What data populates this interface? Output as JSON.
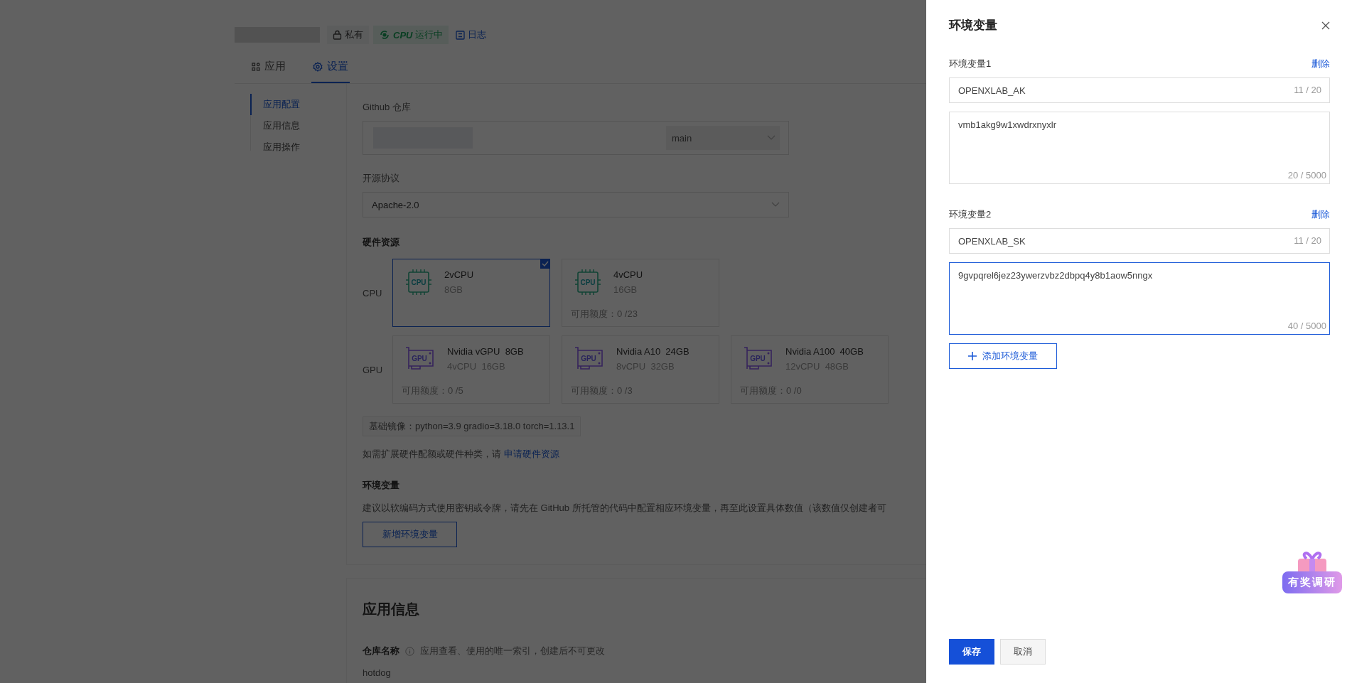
{
  "header": {
    "visibility": "私有",
    "status_hardware": "CPU",
    "status": "运行中",
    "log_link": "日志"
  },
  "tabs": [
    {
      "label": "应用",
      "selected": false
    },
    {
      "label": "设置",
      "selected": true
    }
  ],
  "side_nav": [
    {
      "label": "应用配置",
      "selected": true
    },
    {
      "label": "应用信息",
      "selected": false
    },
    {
      "label": "应用操作",
      "selected": false
    }
  ],
  "config": {
    "repo": {
      "label": "Github 仓库",
      "branch": "main"
    },
    "license": {
      "label": "开源协议",
      "value": "Apache-2.0"
    },
    "hardware": {
      "title": "硬件资源",
      "groups": [
        {
          "label": "CPU",
          "kind": "cpu",
          "options": [
            {
              "icon_text": "CPU",
              "name": "2vCPU",
              "spec": "8GB",
              "selected": true
            },
            {
              "icon_text": "CPU",
              "name": "4vCPU",
              "spec": "16GB",
              "quota": "可用额度：0 /23",
              "selected": false
            }
          ]
        },
        {
          "label": "GPU",
          "kind": "gpu",
          "options": [
            {
              "icon_text": "GPU",
              "name": "Nvidia vGPU  8GB",
              "spec": "4vCPU  16GB",
              "quota": "可用额度：0 /5",
              "selected": false
            },
            {
              "icon_text": "GPU",
              "name": "Nvidia A10  24GB",
              "spec": "8vCPU  32GB",
              "quota": "可用额度：0 /3",
              "selected": false
            },
            {
              "icon_text": "GPU",
              "name": "Nvidia A100  40GB",
              "spec": "12vCPU  48GB",
              "quota": "可用额度：0 /0",
              "selected": false
            }
          ]
        }
      ]
    },
    "base_image": "基础镜像：python=3.9 gradio=3.18.0 torch=1.13.1",
    "expand_note": {
      "text": "如需扩展硬件配额或硬件种类，请",
      "link": "申请硬件资源"
    },
    "env": {
      "title": "环境变量",
      "description": "建议以软编码方式使用密钥或令牌，请先在 GitHub 所托管的代码中配置相应环境变量，再至此设置具体数值（该数值仅创建者可",
      "button": "新增环境变量"
    }
  },
  "app_info": {
    "title": "应用信息",
    "repo_name": {
      "label": "仓库名称",
      "hint": "应用查看、使用的唯一索引，创建后不可更改",
      "value": "hotdog"
    }
  },
  "drawer": {
    "title": "环境变量",
    "variables": [
      {
        "label": "环境变量1",
        "delete": "删除",
        "name": "OPENXLAB_AK",
        "name_count": "11 / 20",
        "value": "vmb1akg9w1xwdrxnyxlr",
        "value_count": "20 / 5000",
        "focused": false
      },
      {
        "label": "环境变量2",
        "delete": "删除",
        "name": "OPENXLAB_SK",
        "name_count": "11 / 20",
        "value": "9gvpqrel6jez23ywerzvbz2dbpq4y8b1aow5nngx",
        "value_count": "40 / 5000",
        "focused": true
      }
    ],
    "add_button": "添加环境变量",
    "save": "保存",
    "cancel": "取消"
  },
  "survey_badge": "有奖调研"
}
